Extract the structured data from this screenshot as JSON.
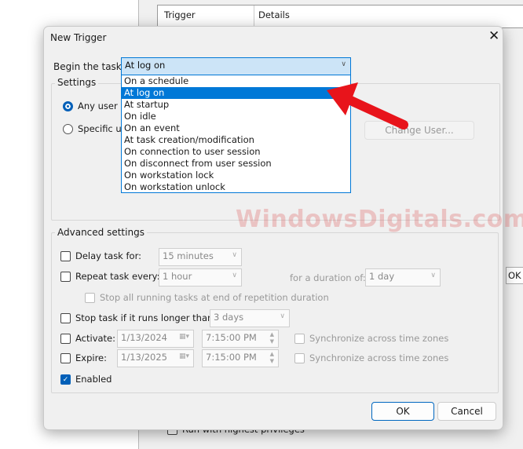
{
  "background": {
    "col_trigger": "Trigger",
    "col_details": "Details",
    "ok": "OK",
    "run_highest": "Run with highest privileges"
  },
  "dialog": {
    "title": "New Trigger",
    "close": "✕",
    "begin_label": "Begin the task:",
    "begin_value": "At log on",
    "options": [
      "On a schedule",
      "At log on",
      "At startup",
      "On idle",
      "On an event",
      "At task creation/modification",
      "On connection to user session",
      "On disconnect from user session",
      "On workstation lock",
      "On workstation unlock"
    ],
    "selected_index": 1,
    "settings": {
      "label": "Settings",
      "any_user": "Any user",
      "specific_user": "Specific us",
      "change_user": "Change User..."
    },
    "advanced": {
      "label": "Advanced settings",
      "delay_label": "Delay task for:",
      "delay_value": "15 minutes",
      "repeat_label": "Repeat task every:",
      "repeat_value": "1 hour",
      "duration_label": "for a duration of:",
      "duration_value": "1 day",
      "stop_all": "Stop all running tasks at end of repetition duration",
      "stop_longer": "Stop task if it runs longer than:",
      "stop_value": "3 days",
      "activate": "Activate:",
      "activate_date": "1/13/2024",
      "activate_time": "7:15:00 PM",
      "expire": "Expire:",
      "expire_date": "1/13/2025",
      "expire_time": "7:15:00 PM",
      "sync": "Synchronize across time zones",
      "enabled": "Enabled"
    },
    "ok": "OK",
    "cancel": "Cancel"
  },
  "watermark": "WindowsDigitals.com",
  "colors": {
    "accent": "#0078d7",
    "arrow": "#e8141b"
  }
}
